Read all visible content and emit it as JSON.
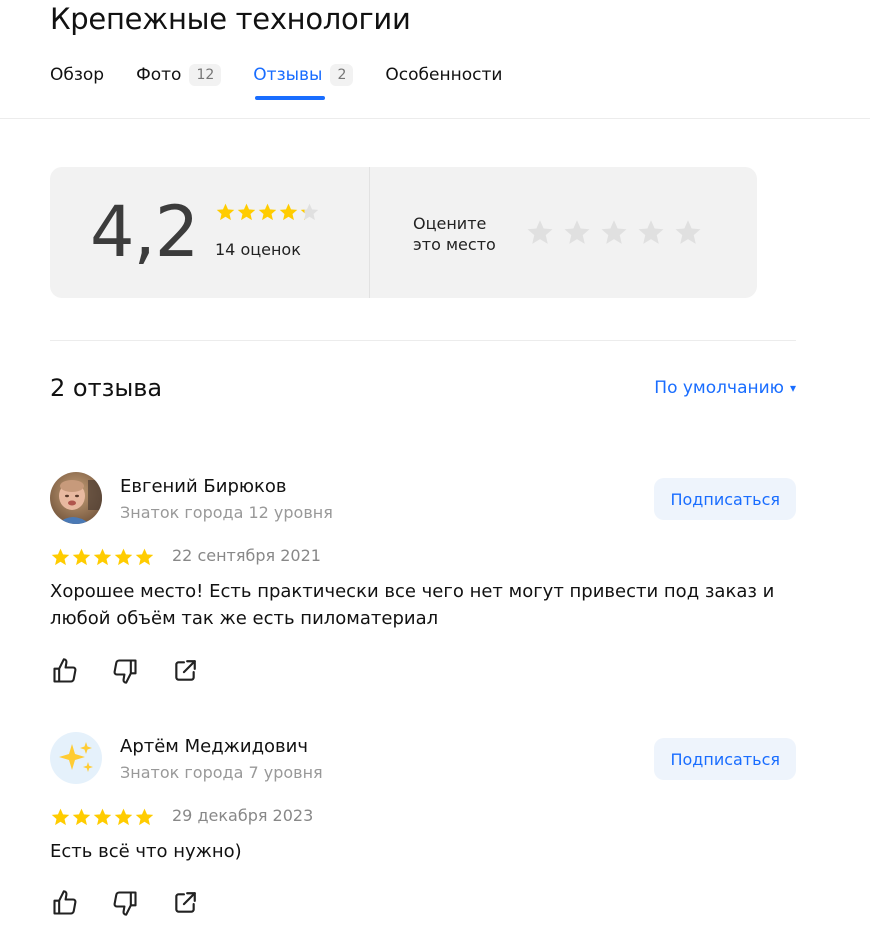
{
  "header": {
    "title": "Крепежные технологии",
    "tabs": [
      {
        "label": "Обзор",
        "badge": ""
      },
      {
        "label": "Фото",
        "badge": "12"
      },
      {
        "label": "Отзывы",
        "badge": "2"
      },
      {
        "label": "Особенности",
        "badge": ""
      }
    ],
    "active_tab": "Отзывы"
  },
  "rating": {
    "value": "4,2",
    "stars": 4.2,
    "count_label": "14 оценок",
    "rate_prompt_line1": "Оцените",
    "rate_prompt_line2": "это место"
  },
  "reviews_section": {
    "heading": "2 отзыва",
    "sort_label": "По умолчанию",
    "sort_caret": "▾"
  },
  "reviews": [
    {
      "author": "Евгений Бирюков",
      "level": "Знаток города 12 уровня",
      "subscribe_label": "Подписаться",
      "stars": 5,
      "date": "22 сентября 2021",
      "text": "Хорошее место! Есть практически все чего нет могут привести под заказ и любой объём так же есть пиломатериал",
      "avatar": "photo-avatar-icon"
    },
    {
      "author": "Артём Меджидович",
      "level": "Знаток города 7 уровня",
      "subscribe_label": "Подписаться",
      "stars": 5,
      "date": "29 декабря 2023",
      "text": "Есть всё что нужно)",
      "avatar": "sparkles-icon"
    }
  ],
  "colors": {
    "accent": "#196dff",
    "star_active": "#fc0",
    "star_inactive": "#e0e0e0",
    "card_bg": "#f2f2f2"
  }
}
